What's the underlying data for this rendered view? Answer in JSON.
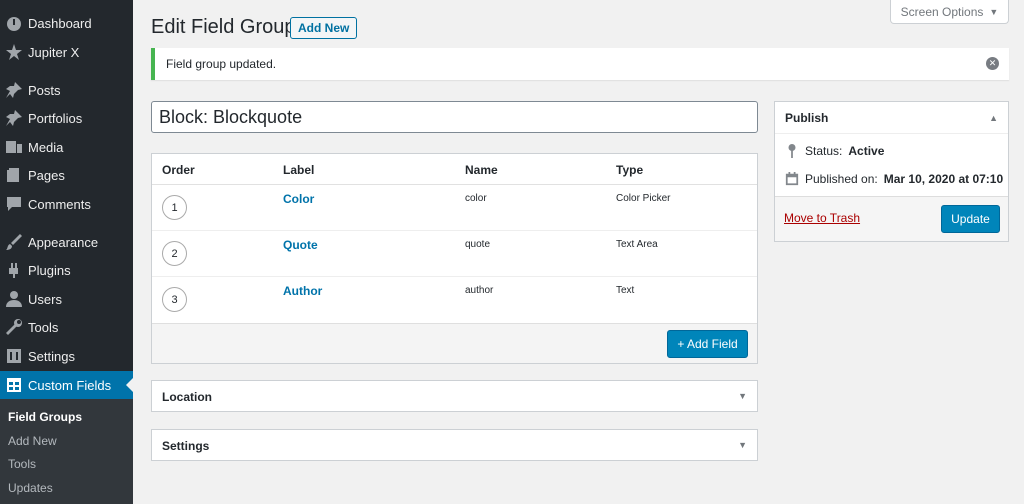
{
  "sidebar": {
    "items": [
      {
        "label": "Dashboard",
        "icon": "dashboard-icon"
      },
      {
        "label": "Jupiter X",
        "icon": "star-icon"
      },
      {
        "label": "Posts",
        "icon": "pin-icon"
      },
      {
        "label": "Portfolios",
        "icon": "pin-icon"
      },
      {
        "label": "Media",
        "icon": "media-icon"
      },
      {
        "label": "Pages",
        "icon": "pages-icon"
      },
      {
        "label": "Comments",
        "icon": "comment-icon"
      },
      {
        "label": "Appearance",
        "icon": "brush-icon"
      },
      {
        "label": "Plugins",
        "icon": "plugin-icon"
      },
      {
        "label": "Users",
        "icon": "user-icon"
      },
      {
        "label": "Tools",
        "icon": "wrench-icon"
      },
      {
        "label": "Settings",
        "icon": "settings-icon"
      },
      {
        "label": "Custom Fields",
        "icon": "table-icon"
      }
    ],
    "submenu": [
      "Field Groups",
      "Add New",
      "Tools",
      "Updates"
    ]
  },
  "header": {
    "screen_options": "Screen Options",
    "title": "Edit Field Group",
    "add_new": "Add New"
  },
  "notice": {
    "text": "Field group updated."
  },
  "title_input": {
    "value": "Block: Blockquote"
  },
  "fields": {
    "columns": [
      "Order",
      "Label",
      "Name",
      "Type"
    ],
    "rows": [
      {
        "order": "1",
        "label": "Color",
        "name": "color",
        "type": "Color Picker"
      },
      {
        "order": "2",
        "label": "Quote",
        "name": "quote",
        "type": "Text Area"
      },
      {
        "order": "3",
        "label": "Author",
        "name": "author",
        "type": "Text"
      }
    ],
    "add_field": "+ Add Field"
  },
  "location": {
    "title": "Location"
  },
  "settings": {
    "title": "Settings"
  },
  "publish": {
    "title": "Publish",
    "status_label": "Status:",
    "status_value": "Active",
    "published_label": "Published on:",
    "published_value": "Mar 10, 2020 at 07:10",
    "trash": "Move to Trash",
    "update": "Update"
  },
  "colors": {
    "sidebar_bg": "#23282d",
    "active_menu": "#0073aa",
    "primary_button": "#0085ba",
    "notice_success": "#46b450",
    "trash_link": "#a00"
  }
}
